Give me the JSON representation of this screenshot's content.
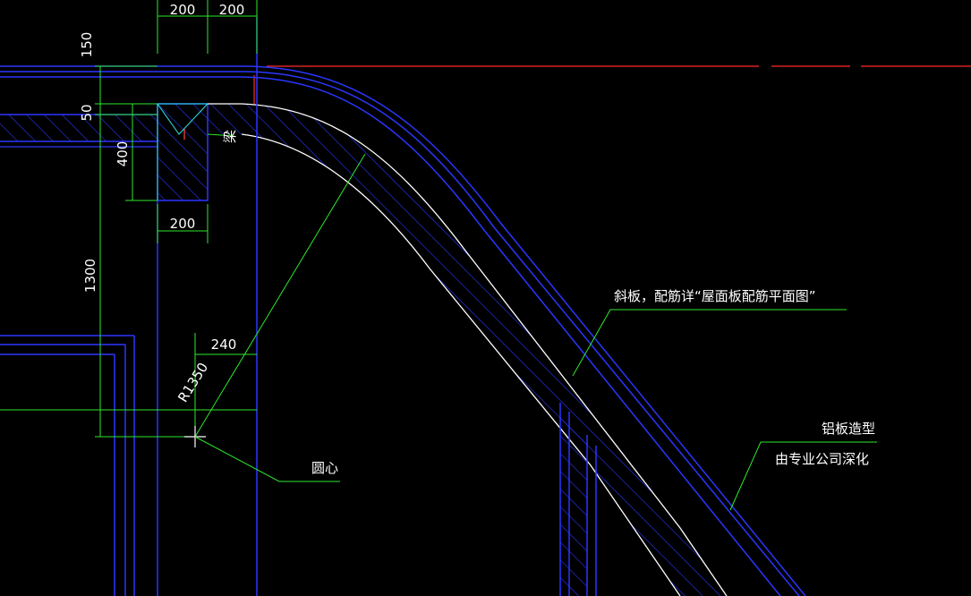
{
  "colors": {
    "background": "#000000",
    "structure": "#2a36ff",
    "dimension": "#2ee82e",
    "hatch": "#2a36ff",
    "slab_edge": "#ffffff",
    "leader": "#2ee82e",
    "text": "#ffffff",
    "red_line": "#ff2a2a",
    "section_mark": "#ff4a4a"
  },
  "dimensions": {
    "width_left": "200",
    "width_right": "200",
    "top_offset": "150",
    "slab_thickness": "50",
    "beam_depth": "400",
    "beam_width": "200",
    "height": "1300",
    "offset": "240",
    "radius": "R1350"
  },
  "labels": {
    "beam": "梁",
    "center": "圆心",
    "slab_note": "斜板，配筋详“屋面板配筋平面图”",
    "cladding_line1": "铝板造型",
    "cladding_line2": "由专业公司深化"
  }
}
